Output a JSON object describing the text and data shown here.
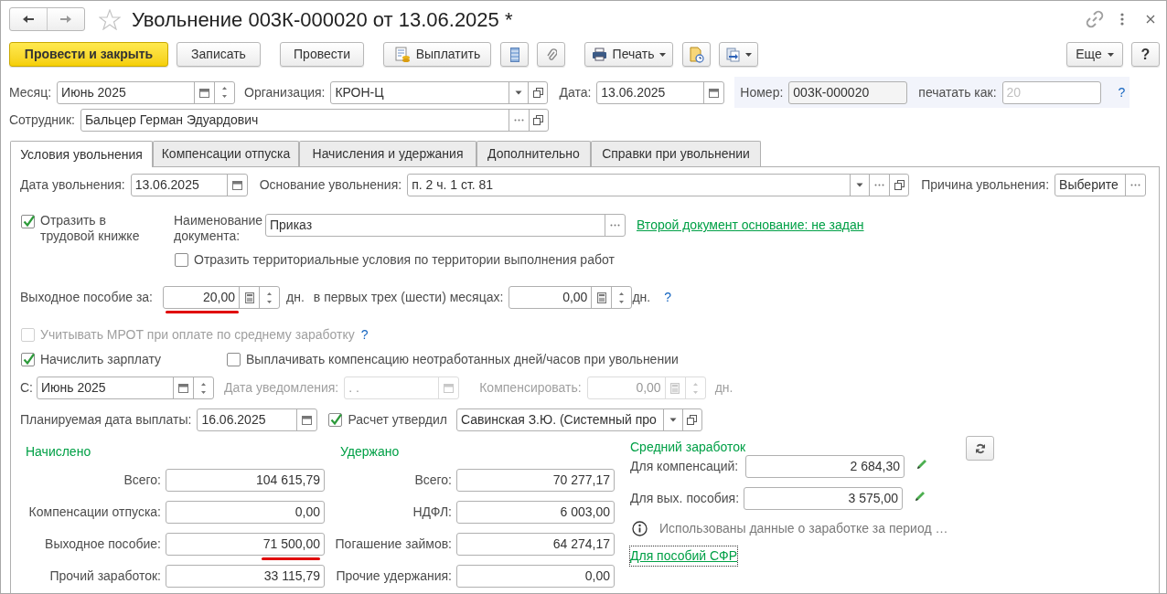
{
  "window": {
    "title": "Увольнение 003К-000020 от 13.06.2025 *"
  },
  "toolbar": {
    "post_close": "Провести и закрыть",
    "save": "Записать",
    "post": "Провести",
    "pay": "Выплатить",
    "print": "Печать",
    "more": "Еще",
    "help": "?"
  },
  "header": {
    "month": {
      "label": "Месяц:",
      "value": "Июнь 2025"
    },
    "organization": {
      "label": "Организация:",
      "value": "КРОН-Ц"
    },
    "date": {
      "label": "Дата:",
      "value": "13.06.2025"
    },
    "number": {
      "label": "Номер:",
      "value": "003К-000020"
    },
    "print_as": {
      "label": "печатать как:",
      "placeholder": "20",
      "help": "?"
    },
    "employee": {
      "label": "Сотрудник:",
      "value": "Бальцер Герман Эдуардович"
    }
  },
  "tabs": [
    {
      "label": "Условия увольнения",
      "selected": true
    },
    {
      "label": "Компенсации отпуска",
      "selected": false
    },
    {
      "label": "Начисления и удержания",
      "selected": false
    },
    {
      "label": "Дополнительно",
      "selected": false
    },
    {
      "label": "Справки при увольнении",
      "selected": false
    }
  ],
  "dismissal": {
    "date": {
      "label": "Дата увольнения:",
      "value": "13.06.2025"
    },
    "basis": {
      "label": "Основание увольнения:",
      "value": "п. 2 ч. 1 ст. 81"
    },
    "reason": {
      "label": "Причина увольнения:",
      "value": "Выберите"
    },
    "workbook": {
      "label": "Отразить в трудовой книжке",
      "checked": true
    },
    "document_name": {
      "label": "Наименование документа:",
      "value": "Приказ"
    },
    "second_document_link": "Второй документ основание: не задан",
    "territorial": {
      "label": "Отразить территориальные условия по территории выполнения работ",
      "checked": false
    },
    "severance": {
      "label": "Выходное пособие за:",
      "value": "20,00",
      "unit": "дн.",
      "underlined": true
    },
    "first_months": {
      "label": "в первых трех (шести) месяцах:",
      "value": "0,00",
      "unit": "дн.",
      "help": "?"
    },
    "mrot": {
      "label": "Учитывать МРОТ при оплате по среднему заработку",
      "checked": false,
      "disabled": true,
      "help": "?"
    },
    "accrue_salary": {
      "label": "Начислить зарплату",
      "checked": true
    },
    "pay_compensation": {
      "label": "Выплачивать компенсацию неотработанных дней/часов при увольнении",
      "checked": false
    },
    "from": {
      "label": "С:",
      "value": "Июнь 2025"
    },
    "notice_date": {
      "label": "Дата уведомления:",
      "value": " .  . ",
      "disabled": true
    },
    "compensate": {
      "label": "Компенсировать:",
      "value": "0,00",
      "unit": "дн.",
      "disabled": true
    },
    "payment_date": {
      "label": "Планируемая дата выплаты:",
      "value": "16.06.2025"
    },
    "approved": {
      "label": "Расчет утвердил",
      "checked": true,
      "value": "Савинская З.Ю. (Системный про"
    }
  },
  "accrued": {
    "title": "Начислено",
    "rows": [
      {
        "label": "Всего:",
        "value": "104 615,79",
        "underlined": false
      },
      {
        "label": "Компенсации отпуска:",
        "value": "0,00",
        "underlined": false
      },
      {
        "label": "Выходное пособие:",
        "value": "71 500,00",
        "underlined": true
      },
      {
        "label": "Прочий заработок:",
        "value": "33 115,79",
        "underlined": false
      }
    ]
  },
  "withheld": {
    "title": "Удержано",
    "rows": [
      {
        "label": "Всего:",
        "value": "70 277,17",
        "underlined": false
      },
      {
        "label": "НДФЛ:",
        "value": "6 003,00",
        "underlined": false
      },
      {
        "label": "Погашение займов:",
        "value": "64 274,17",
        "underlined": false
      },
      {
        "label": "Прочие удержания:",
        "value": "0,00",
        "underlined": false
      }
    ]
  },
  "average": {
    "title": "Средний заработок",
    "rows": [
      {
        "label": "Для компенсаций:",
        "value": "2 684,30"
      },
      {
        "label": "Для вых. пособия:",
        "value": "3 575,00"
      }
    ],
    "info": "Использованы данные о заработке за период …",
    "link": "Для пособий СФР"
  }
}
